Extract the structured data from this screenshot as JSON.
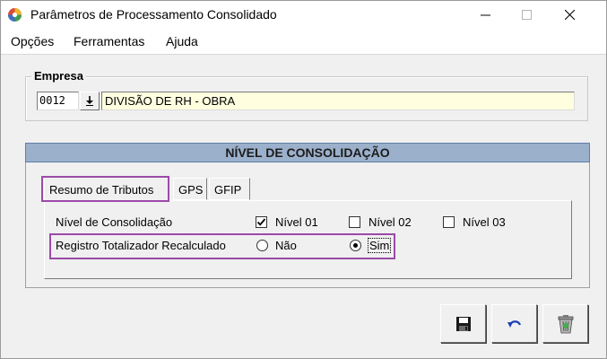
{
  "window": {
    "title": "Parâmetros de Processamento Consolidado",
    "icon": "app-icon"
  },
  "menu": {
    "items": [
      "Opções",
      "Ferramentas",
      "Ajuda"
    ]
  },
  "empresa": {
    "legend": "Empresa",
    "code": "0012",
    "name": "DIVISÃO DE RH - OBRA",
    "lookup_icon": "down-arrow-icon"
  },
  "panel": {
    "header": "NÍVEL DE CONSOLIDAÇÃO",
    "tabs": [
      "Resumo de Tributos",
      "GPS",
      "GFIP"
    ],
    "active_tab": "Resumo de Tributos",
    "nivel_label": "Nível de Consolidação",
    "niveis": [
      {
        "label": "Nível 01",
        "checked": true
      },
      {
        "label": "Nível 02",
        "checked": false
      },
      {
        "label": "Nível 03",
        "checked": false
      }
    ],
    "registro_label": "Registro Totalizador Recalculado",
    "registro_options": [
      {
        "label": "Não",
        "selected": false
      },
      {
        "label": "Sim",
        "selected": true
      }
    ]
  },
  "toolbar": {
    "buttons": [
      "save-icon",
      "undo-icon",
      "delete-icon"
    ]
  },
  "colors": {
    "highlight": "#9c4aa8",
    "panel_header": "#9bb0cb",
    "name_field": "#ffffe0"
  }
}
